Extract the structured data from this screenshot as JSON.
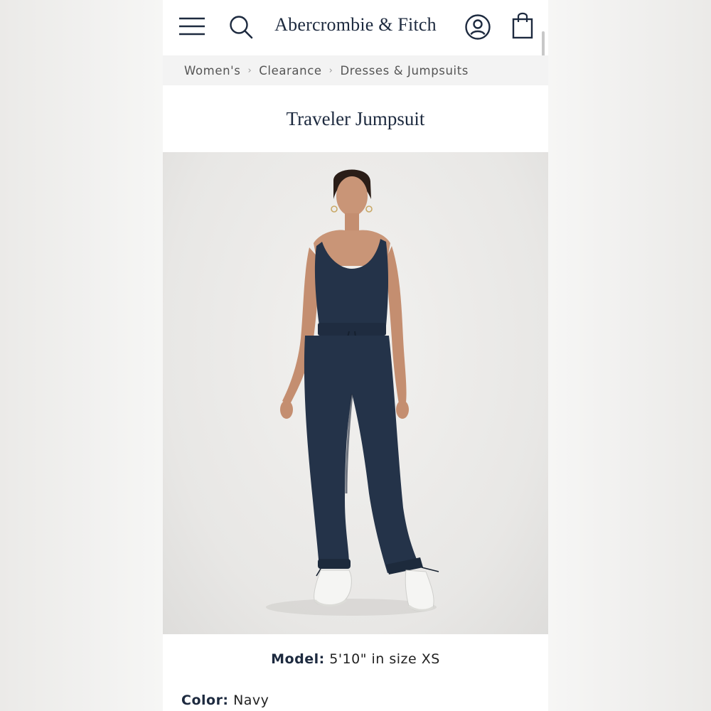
{
  "header": {
    "logo": "Abercrombie & Fitch",
    "icons": [
      "menu-icon",
      "search-icon",
      "account-icon",
      "bag-icon"
    ]
  },
  "breadcrumb": {
    "items": [
      "Women's",
      "Clearance",
      "Dresses & Jumpsuits"
    ],
    "separator": "›"
  },
  "product": {
    "title": "Traveler Jumpsuit",
    "model_label": "Model:",
    "model_value": "5'10\" in size XS",
    "color_label": "Color:",
    "color_value": "Navy"
  },
  "colors": {
    "brand_navy": "#1d2a3f",
    "jumpsuit_navy": "#243349"
  }
}
